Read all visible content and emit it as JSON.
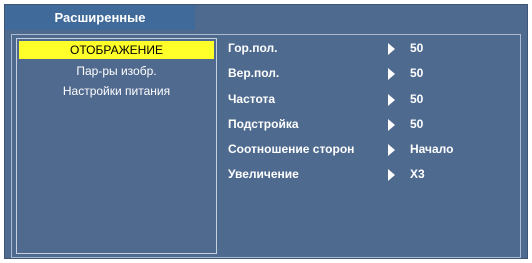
{
  "header": {
    "title": "Расширенные"
  },
  "sidebar": {
    "items": [
      {
        "label": "ОТОБРАЖЕНИЕ",
        "active": true
      },
      {
        "label": "Пар-ры изобр.",
        "active": false
      },
      {
        "label": "Настройки питания",
        "active": false
      }
    ]
  },
  "settings": [
    {
      "label": "Гор.пол.",
      "value": "50"
    },
    {
      "label": "Вер.пол.",
      "value": "50"
    },
    {
      "label": "Частота",
      "value": "50"
    },
    {
      "label": "Подстройка",
      "value": "50"
    },
    {
      "label": "Соотношение сторон",
      "value": "Начало"
    },
    {
      "label": "Увеличение",
      "value": "X3"
    }
  ],
  "colors": {
    "background": "#4e6a8f",
    "header": "#3f6a99",
    "highlight": "#ffff2a",
    "text": "#ffffff"
  }
}
